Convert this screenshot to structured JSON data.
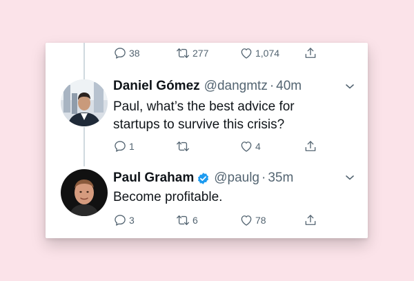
{
  "top_tweet": {
    "actions": {
      "replies": "38",
      "retweets": "277",
      "likes": "1,074"
    }
  },
  "reply_tweet": {
    "display_name": "Daniel Gómez",
    "handle": "@dangmtz",
    "separator": "·",
    "time": "40m",
    "text_line1": "Paul, what’s the best advice for",
    "text_line2": "startups to survive this crisis?",
    "actions": {
      "replies": "1",
      "retweets": "",
      "likes": "4"
    }
  },
  "answer_tweet": {
    "display_name": "Paul Graham",
    "handle": "@paulg",
    "separator": "·",
    "time": "35m",
    "text": "Become profitable.",
    "verified": true,
    "actions": {
      "replies": "3",
      "retweets": "6",
      "likes": "78"
    }
  },
  "colors": {
    "background": "#fbe3e9",
    "card": "#ffffff",
    "text": "#0f1419",
    "secondary": "#536471",
    "verified": "#1d9bf0",
    "thread_line": "#cfd9de"
  },
  "icons": [
    "reply-icon",
    "retweet-icon",
    "like-icon",
    "share-icon",
    "chevron-down-icon",
    "verified-badge-icon"
  ]
}
